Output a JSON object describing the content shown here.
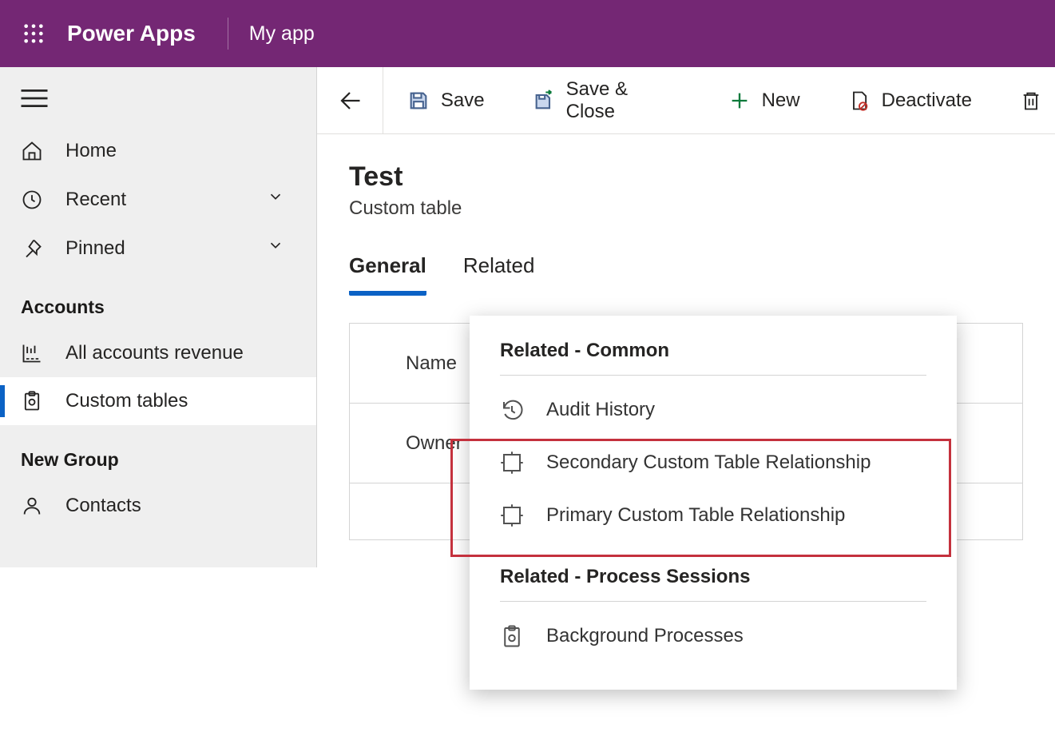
{
  "header": {
    "brand": "Power Apps",
    "app_name": "My app"
  },
  "sidebar": {
    "items": [
      "Home",
      "Recent",
      "Pinned"
    ],
    "group1_header": "Accounts",
    "group1_items": [
      "All accounts revenue",
      "Custom tables"
    ],
    "group2_header": "New Group",
    "group2_items": [
      "Contacts"
    ]
  },
  "commands": {
    "save": "Save",
    "save_close": "Save & Close",
    "new": "New",
    "deactivate": "Deactivate"
  },
  "record": {
    "title": "Test",
    "subtitle": "Custom table"
  },
  "tabs": {
    "general": "General",
    "related": "Related"
  },
  "form": {
    "name_label": "Name",
    "owner_label": "Owner"
  },
  "flyout": {
    "section1_header": "Related - Common",
    "items1": [
      "Audit History",
      "Secondary Custom Table Relationship",
      "Primary Custom Table Relationship"
    ],
    "section2_header": "Related - Process Sessions",
    "items2": [
      "Background Processes"
    ]
  }
}
